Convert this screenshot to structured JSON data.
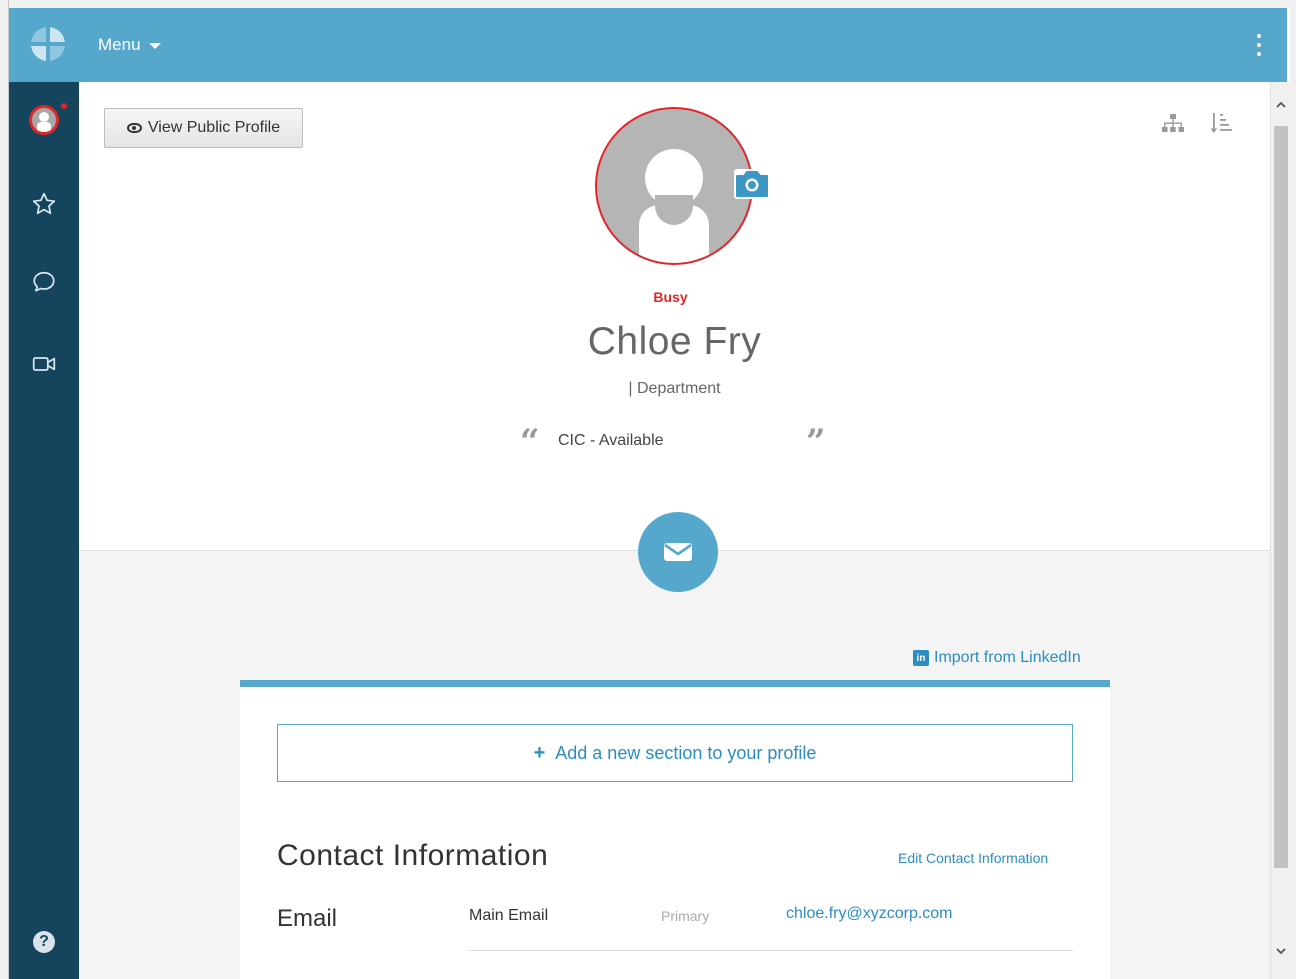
{
  "topbar": {
    "menu_label": "Menu",
    "color": "#55a8cc"
  },
  "sidebar": {
    "color": "#14455d",
    "items": [
      {
        "name": "avatar",
        "icon": "user-avatar-icon"
      },
      {
        "name": "favorites",
        "icon": "star-icon"
      },
      {
        "name": "chat",
        "icon": "chat-bubble-icon"
      },
      {
        "name": "video",
        "icon": "video-camera-icon"
      },
      {
        "name": "help",
        "icon": "help-icon"
      }
    ],
    "help_label": "?"
  },
  "profile": {
    "view_public_label": "View Public Profile",
    "status": "Busy",
    "status_color": "#e0262a",
    "name": "Chloe Fry",
    "department_line": "|  Department",
    "quote": "CIC - Available",
    "quote_open": "“",
    "quote_close": "”"
  },
  "links": {
    "linkedin_label": "Import from LinkedIn",
    "linkedin_badge": "in"
  },
  "card": {
    "add_section_label": "Add a new section to your profile",
    "add_section_plus": "+",
    "section_title": "Contact Information",
    "edit_label": "Edit Contact Information",
    "rows": [
      {
        "label": "Email",
        "type": "Main Email",
        "flag": "Primary",
        "value": "chloe.fry@xyzcorp.com"
      }
    ]
  }
}
